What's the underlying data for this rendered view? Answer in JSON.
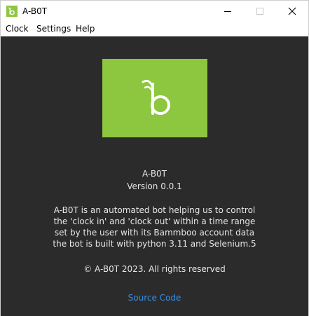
{
  "window": {
    "title": "A-B0T",
    "icon": "bamboo-b-icon"
  },
  "window_controls": {
    "minimize_icon": "minimize-icon",
    "maximize_icon": "maximize-icon",
    "close_icon": "close-icon"
  },
  "menu": {
    "items": [
      {
        "label": "Clock"
      },
      {
        "label": "Settings"
      },
      {
        "label": "Help"
      }
    ]
  },
  "about": {
    "logo_icon": "bamboo-b-logo",
    "app_name": "A-B0T",
    "version": "Version 0.0.1",
    "description_lines": [
      "A-B0T is an automated bot helping us to control",
      "the 'clock in' and 'clock out' within a time range",
      "set by the user with its Bammboo account data",
      "the bot is built with python 3.11 and Selenium.5"
    ],
    "copyright": "© A-B0T 2023. All rights reserved",
    "source_link": "Source Code"
  },
  "colors": {
    "accent_green": "#8dc63f",
    "background_dark": "#2b2b2b",
    "text_light": "#e6e6e6",
    "link_blue": "#3a8ee6"
  }
}
